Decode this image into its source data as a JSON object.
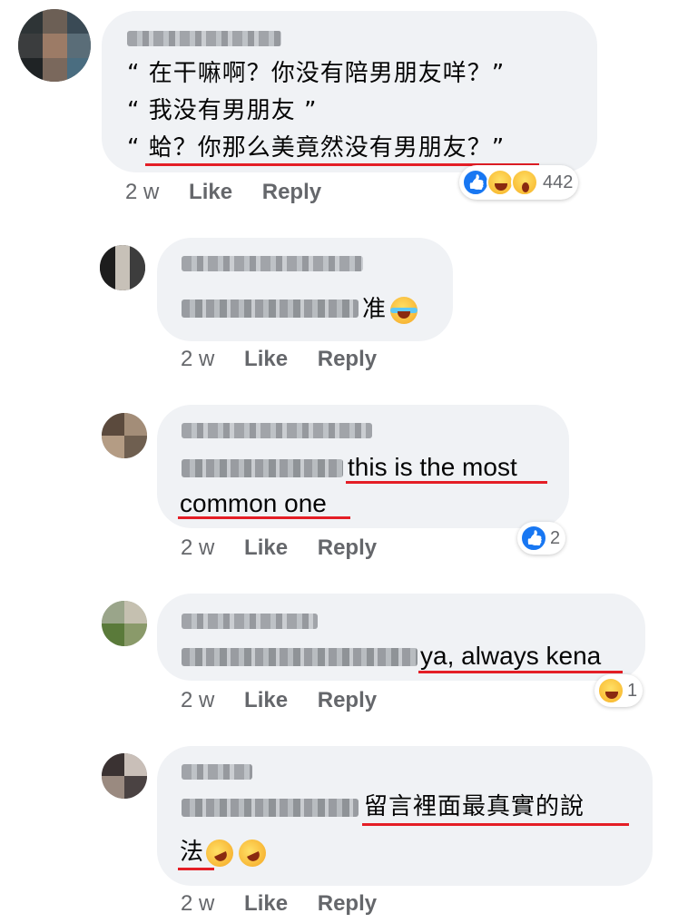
{
  "comments": [
    {
      "lines": [
        "“ 在干嘛啊？你没有陪男朋友咩？”",
        "“ 我没有男朋友 ”",
        "“ 蛤？你那么美竟然没有男朋友？”"
      ],
      "time": "2 w",
      "like": "Like",
      "reply": "Reply",
      "reaction_count": "442",
      "reaction_icons": [
        "like-icon",
        "haha-icon",
        "wow-icon"
      ]
    },
    {
      "text": "准",
      "emoji": "tears-of-joy-emoji",
      "time": "2 w",
      "like": "Like",
      "reply": "Reply"
    },
    {
      "text_line1": "this is the most",
      "text_line2": "common one",
      "time": "2 w",
      "like": "Like",
      "reply": "Reply",
      "reaction_count": "2",
      "reaction_icons": [
        "like-icon"
      ]
    },
    {
      "text": "ya, always kena",
      "time": "2 w",
      "like": "Like",
      "reply": "Reply",
      "reaction_count": "1",
      "reaction_icons": [
        "haha-icon"
      ]
    },
    {
      "text_line1": "留言裡面最真實的說",
      "text_line2": "法",
      "emoji": "rolling-on-floor-laughing-emoji",
      "time": "2 w",
      "like": "Like",
      "reply": "Reply"
    }
  ],
  "colors": {
    "bubble": "#f0f2f5",
    "meta": "#65676b",
    "underline": "#e41e26",
    "like_blue": "#1877f2"
  }
}
